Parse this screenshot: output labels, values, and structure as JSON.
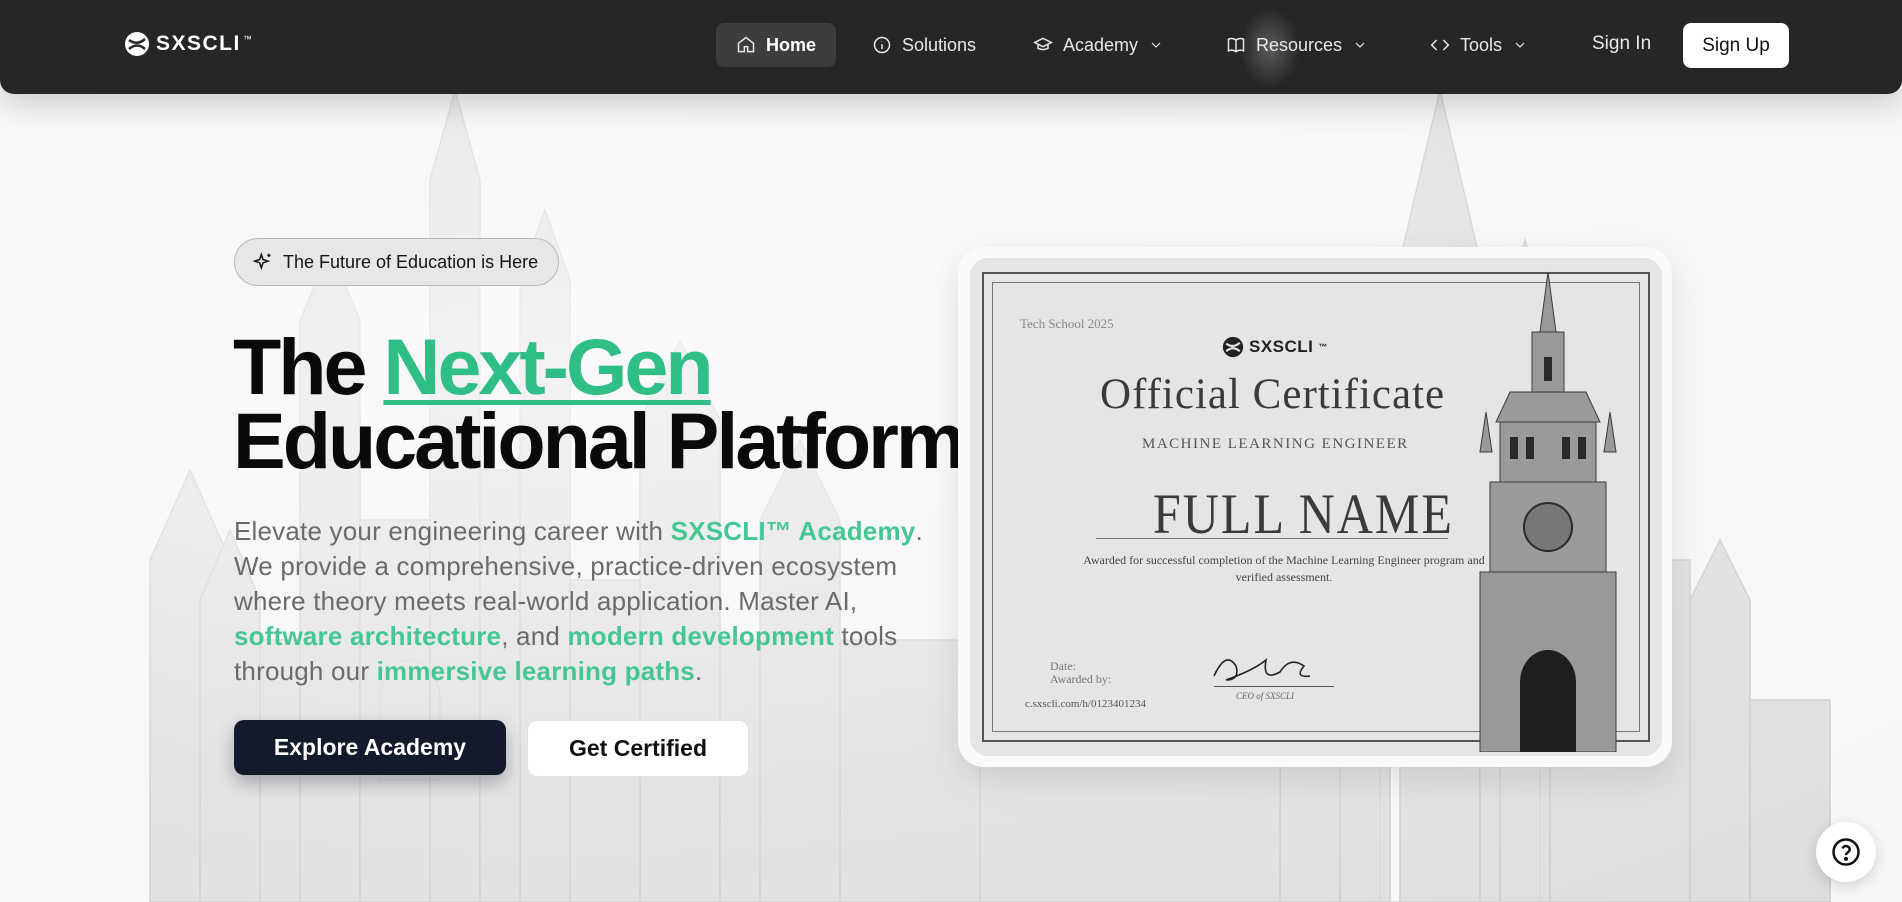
{
  "brand": {
    "name": "SXSCLI",
    "tm": "™"
  },
  "nav": {
    "items": [
      {
        "label": "Home",
        "icon": "home-icon",
        "active": true
      },
      {
        "label": "Solutions",
        "icon": "info-icon"
      },
      {
        "label": "Academy",
        "icon": "graduation-cap-icon",
        "dropdown": true
      },
      {
        "label": "Resources",
        "icon": "book-icon",
        "dropdown": true
      },
      {
        "label": "Tools",
        "icon": "code-icon",
        "dropdown": true
      }
    ],
    "signin": "Sign In",
    "signup": "Sign Up"
  },
  "hero": {
    "badge": "The Future of Education is Here",
    "title_start": "The ",
    "title_accent": "Next-Gen",
    "title_end": "Educational Platform",
    "lede": {
      "p1": "Elevate your engineering career with ",
      "hl1": "SXSCLI™ Academy",
      "p2": ". We provide a comprehensive, practice-driven ecosystem where theory meets real-world application. Master AI, ",
      "hl2": "software architecture",
      "p3": ", and ",
      "hl3": "modern development",
      "p4": " tools through our ",
      "hl4": "immersive learning paths",
      "p5": "."
    },
    "primary_cta": "Explore Academy",
    "secondary_cta": "Get Certified"
  },
  "certificate": {
    "school": "Tech School 2025",
    "brand": "SXSCLI",
    "tm": "™",
    "title": "Official Certificate",
    "subtitle": "MACHINE LEARNING ENGINEER",
    "name": "FULL NAME",
    "description": "Awarded for successful completion of the Machine Learning Engineer program and verified assessment.",
    "date_label": "Date:",
    "awarded_label": "Awarded by:",
    "url": "c.sxscli.com/h/0123401234",
    "signer_role": "CEO of SXSCLI"
  },
  "colors": {
    "accent": "#2fbf86",
    "nav_bg": "#262626",
    "primary_btn": "#131a2b"
  },
  "help": {
    "icon": "question-circle-icon"
  }
}
